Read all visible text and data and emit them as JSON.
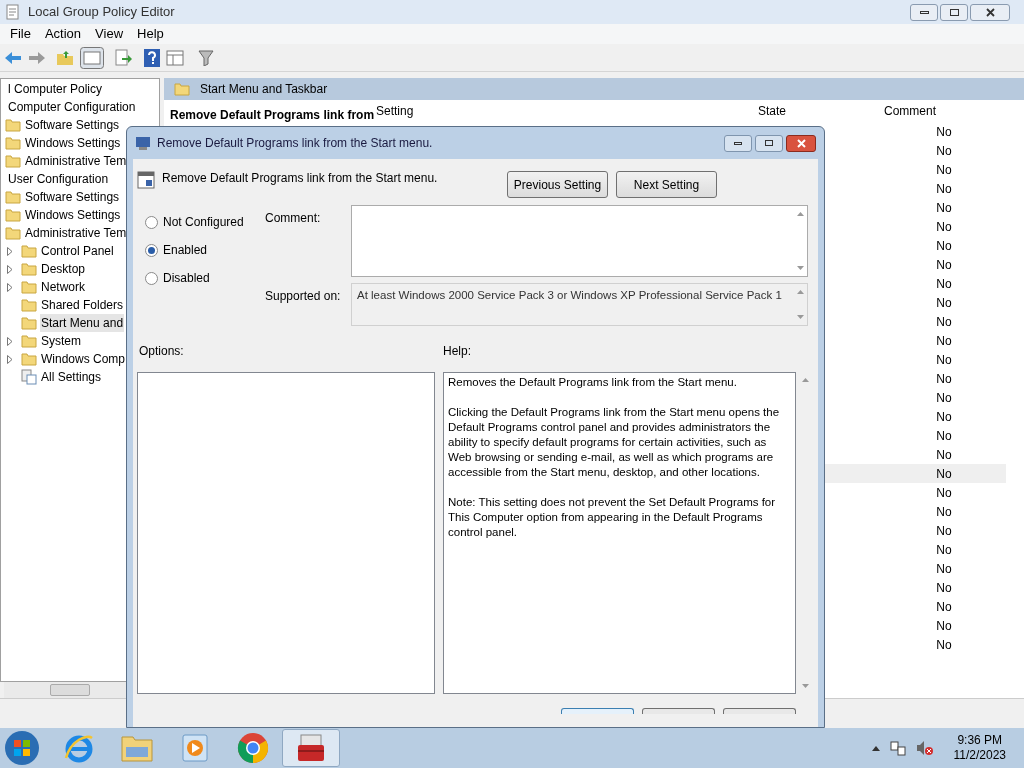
{
  "window": {
    "title": "Local Group Policy Editor"
  },
  "menu": [
    "File",
    "Action",
    "View",
    "Help"
  ],
  "tree": [
    {
      "label": "l Computer Policy",
      "children": [
        {
          "label": "Computer Configuration",
          "children": [
            {
              "label": "Software Settings",
              "kind": "folder",
              "selected": false
            },
            {
              "label": "Windows Settings",
              "kind": "folder",
              "selected": false
            },
            {
              "label": "Administrative Tem",
              "kind": "folder",
              "selected": false
            }
          ]
        },
        {
          "label": "User Configuration",
          "children": [
            {
              "label": "Software Settings",
              "kind": "folder",
              "selected": false
            },
            {
              "label": "Windows Settings",
              "kind": "folder",
              "selected": false
            },
            {
              "label": "Administrative Tem",
              "kind": "folder",
              "selected": false,
              "children": [
                {
                  "label": "Control Panel",
                  "kind": "folder",
                  "expandable": true,
                  "selected": false
                },
                {
                  "label": "Desktop",
                  "kind": "folder",
                  "expandable": true,
                  "selected": false
                },
                {
                  "label": "Network",
                  "kind": "folder",
                  "expandable": true,
                  "selected": false
                },
                {
                  "label": "Shared Folders",
                  "kind": "folder",
                  "expandable": false,
                  "selected": false
                },
                {
                  "label": "Start Menu and",
                  "kind": "folder",
                  "expandable": false,
                  "selected": true
                },
                {
                  "label": "System",
                  "kind": "folder",
                  "expandable": true,
                  "selected": false
                },
                {
                  "label": "Windows Comp",
                  "kind": "folder",
                  "expandable": true,
                  "selected": false
                },
                {
                  "label": "All Settings",
                  "kind": "settings",
                  "expandable": false,
                  "selected": false
                }
              ]
            }
          ]
        }
      ]
    }
  ],
  "right_pane": {
    "header": "Start Menu and Taskbar",
    "description_title": "Remove Default Programs link from",
    "columns": [
      "Setting",
      "State",
      "Comment"
    ],
    "rows": [
      {
        "comment": "No",
        "selected": false
      },
      {
        "comment": "No",
        "selected": false
      },
      {
        "comment": "No",
        "selected": false
      },
      {
        "comment": "No",
        "selected": false
      },
      {
        "comment": "No",
        "selected": false
      },
      {
        "comment": "No",
        "selected": false
      },
      {
        "comment": "No",
        "selected": false
      },
      {
        "comment": "No",
        "selected": false
      },
      {
        "comment": "No",
        "selected": false
      },
      {
        "comment": "No",
        "selected": false
      },
      {
        "comment": "No",
        "selected": false
      },
      {
        "comment": "No",
        "selected": false
      },
      {
        "comment": "No",
        "selected": false
      },
      {
        "comment": "No",
        "selected": false
      },
      {
        "comment": "No",
        "selected": false
      },
      {
        "comment": "No",
        "selected": false
      },
      {
        "comment": "No",
        "selected": false
      },
      {
        "comment": "No",
        "selected": false
      },
      {
        "comment": "No",
        "selected": true
      },
      {
        "comment": "No",
        "selected": false
      },
      {
        "comment": "No",
        "selected": false
      },
      {
        "comment": "No",
        "selected": false
      },
      {
        "comment": "No",
        "selected": false
      },
      {
        "comment": "No",
        "selected": false
      },
      {
        "comment": "No",
        "selected": false
      },
      {
        "comment": "No",
        "selected": false
      },
      {
        "comment": "No",
        "selected": false
      },
      {
        "comment": "No",
        "selected": false
      }
    ]
  },
  "dialog": {
    "title": "Remove Default Programs link from the Start menu.",
    "setting_name": "Remove Default Programs link from the Start menu.",
    "buttons": [
      "Previous Setting",
      "Next Setting"
    ],
    "options": [
      {
        "label": "Not Configured",
        "selected": false
      },
      {
        "label": "Enabled",
        "selected": true
      },
      {
        "label": "Disabled",
        "selected": false
      }
    ],
    "comment_label": "Comment:",
    "supported_label": "Supported on:",
    "supported_value": "At least Windows 2000 Service Pack 3 or Windows XP Professional Service Pack 1",
    "options_label": "Options:",
    "help_label": "Help:",
    "help_paragraphs": [
      "Removes the Default Programs link from the Start menu.",
      "Clicking the Default Programs link from the Start menu opens the Default Programs control panel and provides administrators the ability to specify default programs for certain activities, such as Web browsing or sending e-mail, as well as which programs are accessible from the Start menu, desktop, and other locations.",
      "Note: This setting does not prevent the Set Default Programs for This Computer option from appearing in the Default Programs control panel."
    ]
  },
  "taskbar": {
    "apps": [
      {
        "kind": "browser-e",
        "selected": false
      },
      {
        "kind": "explorer",
        "selected": false
      },
      {
        "kind": "media",
        "selected": false
      },
      {
        "kind": "chrome",
        "selected": false
      },
      {
        "kind": "toolbox",
        "selected": true
      }
    ],
    "time": "9:36 PM",
    "date": "11/2/2023"
  }
}
